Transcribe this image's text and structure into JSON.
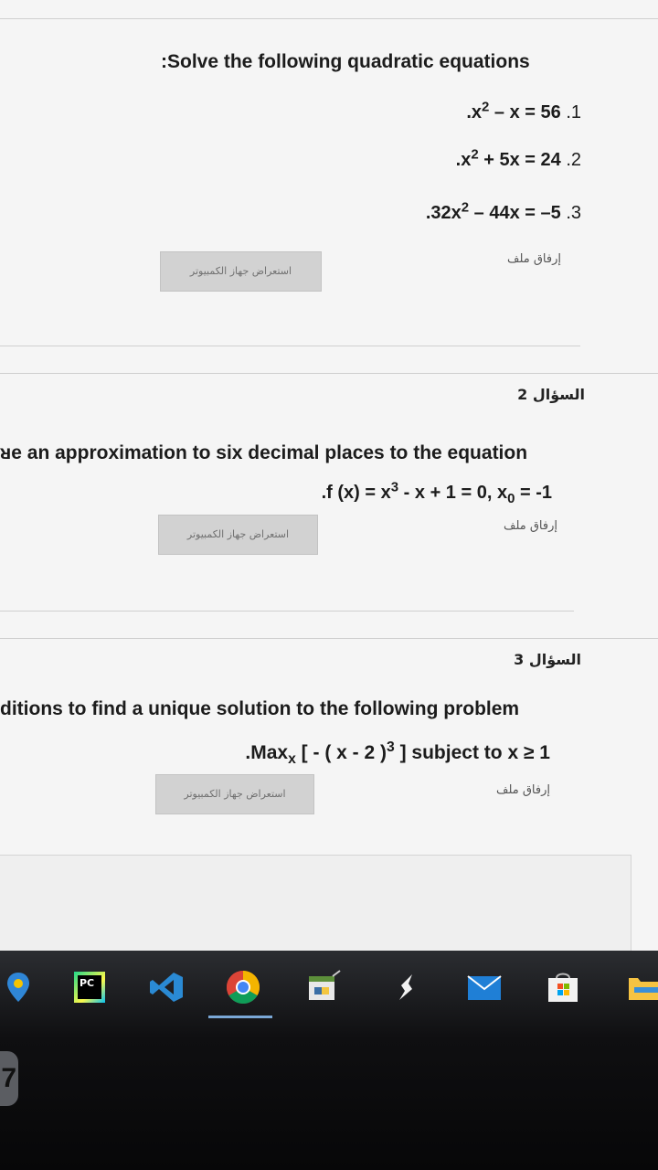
{
  "question1": {
    "title": ":Solve the following quadratic equations",
    "equations": [
      {
        "prefix": ".x",
        "exp": "2",
        "rest": " – x = 56 ",
        "num": ".1"
      },
      {
        "prefix": ".x",
        "exp": "2",
        "rest": " + 5x = 24 ",
        "num": ".2"
      },
      {
        "prefix": ".32x",
        "exp": "2",
        "rest": " – 44x = –5 ",
        "num": ".3"
      }
    ],
    "browse_label": "استعراض جهاز الكمبيوتر",
    "attach_label": "إرفاق ملف"
  },
  "question2": {
    "heading": "السؤال 2",
    "text": "ᴚe an approximation to six decimal places to the equation",
    "eq_parts": {
      "a": ".f (x) = x",
      "exp": "3",
      "b": " - x + 1 = 0, x",
      "sub": "0",
      "c": " = -1"
    },
    "browse_label": "استعراض جهاز الكمبيوتر",
    "attach_label": "إرفاق ملف"
  },
  "question3": {
    "heading": "السؤال 3",
    "text": "ditions to find a unique solution to the following problem",
    "eq_parts": {
      "a": ".Max",
      "sub": "x",
      "b": " [ - ( x - 2 )",
      "exp": "3",
      "c": " ] subject to x ≥ 1"
    },
    "browse_label": "استعراض جهاز الكمبيوتر",
    "attach_label": "إرفاق ملف"
  },
  "taskbar": {
    "pycharm_label": "PC",
    "icons": [
      "map-pin-icon",
      "pycharm-icon",
      "vscode-icon",
      "chrome-icon",
      "python-idle-icon",
      "pen-icon",
      "mail-icon",
      "store-icon",
      "file-explorer-icon"
    ],
    "colors": {
      "accent": "#7aa7d6",
      "vscode": "#2a8ad4",
      "mail": "#1f7fd6"
    }
  }
}
